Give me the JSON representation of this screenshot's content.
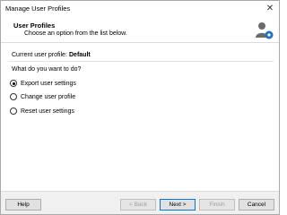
{
  "window": {
    "title": "Manage User Profiles"
  },
  "header": {
    "title": "User Profiles",
    "subtitle": "Choose an option from the list below.",
    "icon": "user-settings-icon"
  },
  "content": {
    "current_profile_label": "Current user profile:",
    "current_profile_value": "Default",
    "question": "What do you want to do?",
    "options": [
      {
        "label": "Export user settings",
        "selected": true
      },
      {
        "label": "Change user profile",
        "selected": false
      },
      {
        "label": "Reset user settings",
        "selected": false
      }
    ]
  },
  "footer": {
    "help": "Help",
    "back": "< Back",
    "next": "Next >",
    "finish": "Finish",
    "cancel": "Cancel"
  },
  "colors": {
    "accent": "#0078d7",
    "footer_bg": "#f0f0f0"
  }
}
